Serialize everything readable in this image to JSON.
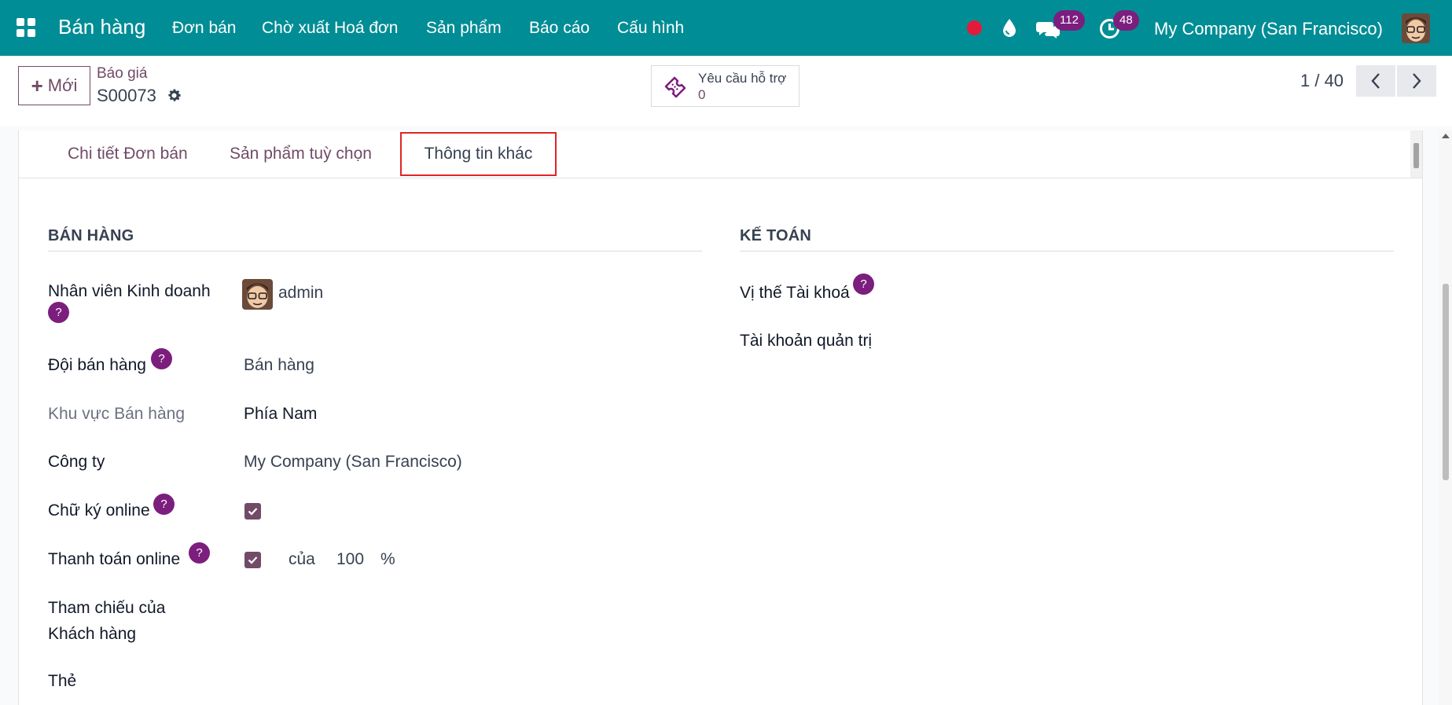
{
  "navbar": {
    "app_title": "Bán hàng",
    "menu": [
      "Đơn bán",
      "Chờ xuất Hoá đơn",
      "Sản phẩm",
      "Báo cáo",
      "Cấu hình"
    ],
    "messages_badge": "112",
    "activities_badge": "48",
    "company": "My Company (San Francisco)",
    "accent": "#018d95"
  },
  "control": {
    "new_label": "Mới",
    "breadcrumb_parent": "Báo giá",
    "breadcrumb_current": "S00073",
    "ticket_label": "Yêu cầu hỗ trợ",
    "ticket_count": "0",
    "pager": "1 / 40"
  },
  "tabs": {
    "items": [
      "Chi tiết Đơn bán",
      "Sản phẩm tuỳ chọn"
    ],
    "active": "Thông tin khác"
  },
  "sales": {
    "title": "BÁN HÀNG",
    "salesperson_label": "Nhân viên Kinh doanh",
    "salesperson_value": "admin",
    "team_label": "Đội bán hàng",
    "team_value": "Bán hàng",
    "region_label": "Khu vực Bán hàng",
    "region_value": "Phía Nam",
    "company_label": "Công ty",
    "company_value": "My Company (San Francisco)",
    "signature_label": "Chữ ký online",
    "signature_checked": true,
    "payment_label": "Thanh toán online",
    "payment_checked": true,
    "payment_of": "của",
    "payment_percent": "100",
    "payment_unit": "%",
    "customer_ref_label_1": "Tham chiếu của",
    "customer_ref_label_2": "Khách hàng",
    "tags_label": "Thẻ"
  },
  "accounting": {
    "title": "KẾ TOÁN",
    "fiscal_position_label": "Vị thế Tài khoá",
    "analytic_account_label": "Tài khoản quản trị"
  },
  "help_mark": "?"
}
